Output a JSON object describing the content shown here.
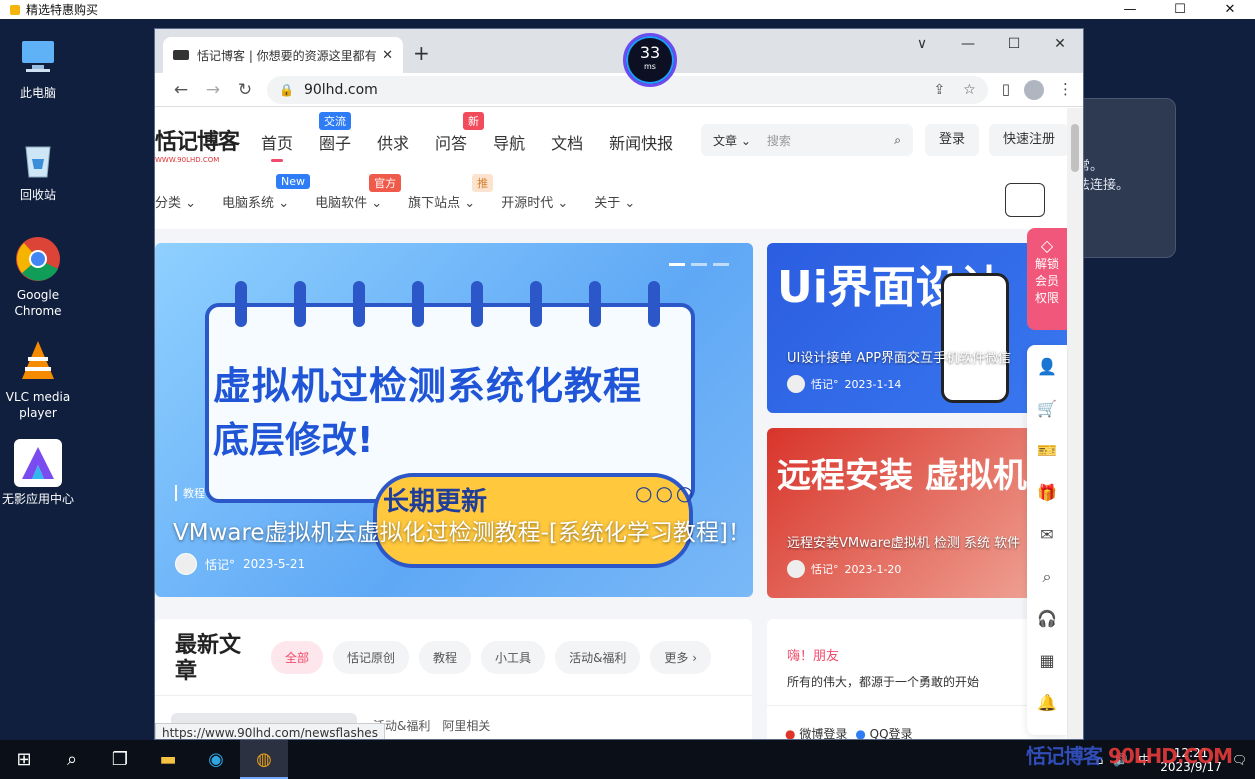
{
  "outer_window": {
    "title": "精选特惠购买",
    "controls": [
      "—",
      "☐",
      "✕"
    ]
  },
  "desktop_icons": [
    {
      "label": "此电脑",
      "icon": "computer-icon"
    },
    {
      "label": "回收站",
      "icon": "recycle-bin-icon"
    },
    {
      "label": "Google Chrome",
      "icon": "chrome-icon"
    },
    {
      "label": "VLC media player",
      "icon": "vlc-icon"
    },
    {
      "label": "无影应用中心",
      "icon": "wuying-icon"
    }
  ],
  "bg_dialog": {
    "line1": "常。",
    "line2": "法连接。"
  },
  "browser": {
    "tab_title": "恬记博客 | 你想要的资源这里都有",
    "new_tab": "+",
    "window_controls": [
      "∨",
      "—",
      "☐",
      "✕"
    ],
    "url": "90lhd.com"
  },
  "ping": {
    "value": "33",
    "unit": "ms"
  },
  "site": {
    "logo": "恬记博客",
    "logo_sub": "WWW.90LHD.COM",
    "nav": [
      {
        "label": "首页",
        "badge": ""
      },
      {
        "label": "圈子",
        "badge": "交流"
      },
      {
        "label": "供求",
        "badge": ""
      },
      {
        "label": "问答",
        "badge": "新"
      },
      {
        "label": "导航",
        "badge": ""
      },
      {
        "label": "文档",
        "badge": ""
      },
      {
        "label": "新闻快报",
        "badge": ""
      }
    ],
    "search": {
      "scope": "文章",
      "placeholder": "搜索"
    },
    "login": "登录",
    "register": "快速注册",
    "subnav": [
      {
        "label": "分类",
        "badge": ""
      },
      {
        "label": "电脑系统",
        "badge": "New"
      },
      {
        "label": "电脑软件",
        "badge": "官方"
      },
      {
        "label": "旗下站点",
        "badge": "推"
      },
      {
        "label": "开源时代",
        "badge": ""
      },
      {
        "label": "关于",
        "badge": ""
      }
    ]
  },
  "hero": {
    "line1": "虚拟机过检测系统化教程",
    "line2": "底层修改!",
    "ribbon": "长期更新",
    "category": "教程",
    "title": "VMware虚拟机去虚拟化过检测教程-[系统化学习教程]！",
    "author": "恬记°",
    "date": "2023-5-21"
  },
  "side_posts": [
    {
      "big": "Ui界面设计",
      "title": "UI设计接单 APP界面交互手机软件微信",
      "author": "恬记°",
      "date": "2023-1-14"
    },
    {
      "big": "远程安装 虚拟机",
      "title": "远程安装VMware虚拟机 检测 系统 软件",
      "author": "恬记°",
      "date": "2023-1-20"
    }
  ],
  "latest": {
    "heading": "最新文章",
    "tabs": [
      "全部",
      "恬记原创",
      "教程",
      "小工具",
      "活动&福利",
      "更多 ›"
    ],
    "row": [
      "活动&福利",
      "阿里相关"
    ]
  },
  "hello": {
    "greeting": "嗨！朋友",
    "slogan": "所有的伟大，都源于一个勇敢的开始",
    "logins": [
      "微博登录",
      "QQ登录"
    ]
  },
  "status_url": "https://www.90lhd.com/newsflashes",
  "vip": {
    "label1": "解锁",
    "label2": "会员",
    "label3": "权限"
  },
  "rail_icons": [
    "user-icon",
    "cart-icon",
    "ticket-icon",
    "gift-icon",
    "mail-icon",
    "search-icon",
    "headset-icon",
    "qrcode-icon",
    "bell-icon"
  ],
  "taskbar": {
    "time": "12:21",
    "date": "2023/9/17",
    "ime": "中",
    "watermark_a": "恬记博客",
    "watermark_b": "90LHD.COM"
  }
}
